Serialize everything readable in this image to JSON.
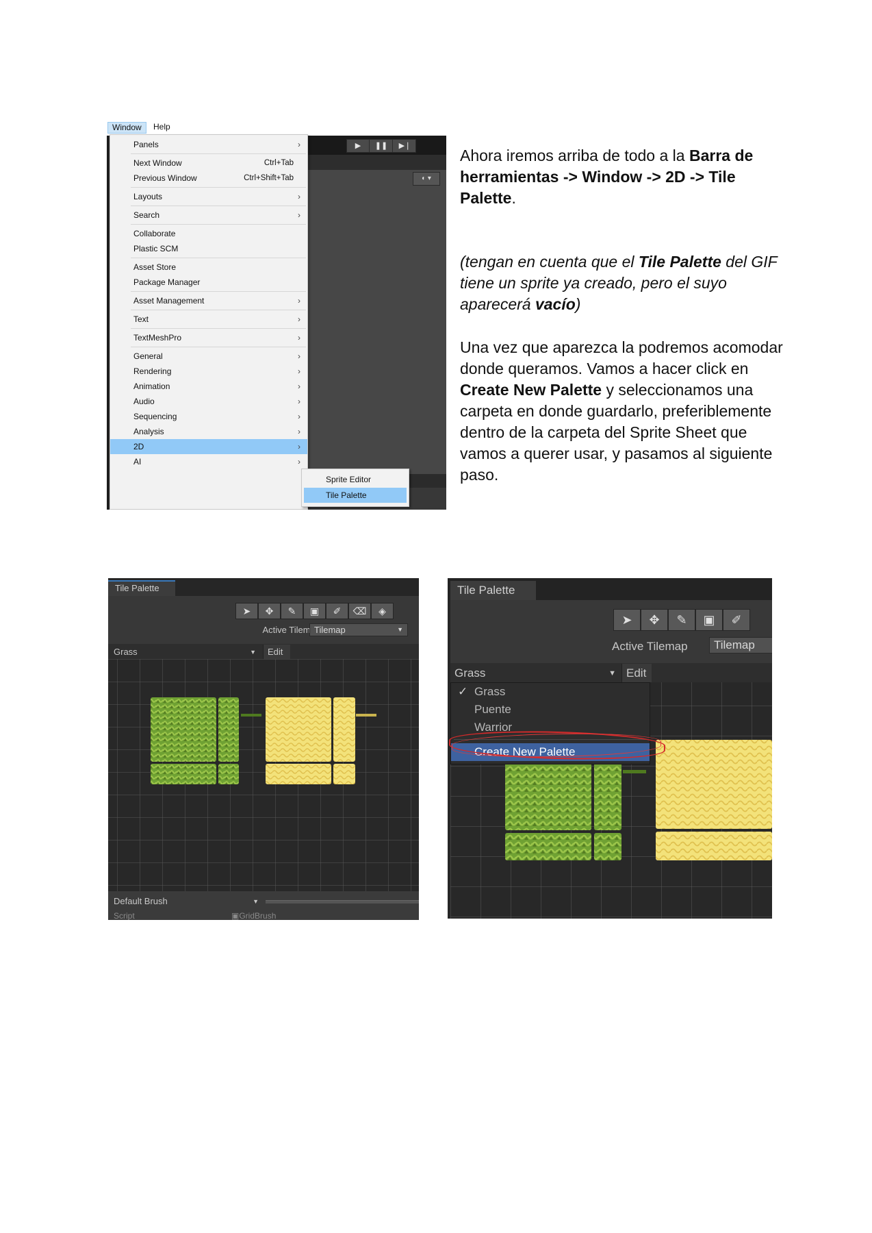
{
  "top_screenshot": {
    "menubar": {
      "window": "Window",
      "help": "Help"
    },
    "window_menu": {
      "items": [
        {
          "label": "Panels",
          "shortcut": "",
          "submenu": true
        },
        {
          "label": "Next Window",
          "shortcut": "Ctrl+Tab",
          "submenu": false
        },
        {
          "label": "Previous Window",
          "shortcut": "Ctrl+Shift+Tab",
          "submenu": false
        },
        {
          "label": "Layouts",
          "shortcut": "",
          "submenu": true
        },
        {
          "label": "Search",
          "shortcut": "",
          "submenu": true
        },
        {
          "label": "Collaborate",
          "shortcut": "",
          "submenu": false
        },
        {
          "label": "Plastic SCM",
          "shortcut": "",
          "submenu": false
        },
        {
          "label": "Asset Store",
          "shortcut": "",
          "submenu": false
        },
        {
          "label": "Package Manager",
          "shortcut": "",
          "submenu": false
        },
        {
          "label": "Asset Management",
          "shortcut": "",
          "submenu": true
        },
        {
          "label": "Text",
          "shortcut": "",
          "submenu": true
        },
        {
          "label": "TextMeshPro",
          "shortcut": "",
          "submenu": true
        },
        {
          "label": "General",
          "shortcut": "",
          "submenu": true
        },
        {
          "label": "Rendering",
          "shortcut": "",
          "submenu": true
        },
        {
          "label": "Animation",
          "shortcut": "",
          "submenu": true
        },
        {
          "label": "Audio",
          "shortcut": "",
          "submenu": true
        },
        {
          "label": "Sequencing",
          "shortcut": "",
          "submenu": true
        },
        {
          "label": "Analysis",
          "shortcut": "",
          "submenu": true
        },
        {
          "label": "2D",
          "shortcut": "",
          "submenu": true,
          "selected": true
        },
        {
          "label": "AI",
          "shortcut": "",
          "submenu": true
        }
      ],
      "arrow_glyph": "›"
    },
    "submenu_2d": {
      "items": [
        {
          "label": "Sprite Editor"
        },
        {
          "label": "Tile Palette",
          "selected": true
        }
      ]
    }
  },
  "instructions": {
    "p1_a": "Ahora iremos arriba de todo a la ",
    "p1_b": "Barra de herramientas -> Window -> 2D -> Tile Palette",
    "p1_c": ".",
    "p2_a": "(tengan en cuenta que el ",
    "p2_b": "Tile Palette",
    "p2_c": " del GIF tiene un sprite ya creado, pero el suyo aparecerá ",
    "p2_d": "vacío",
    "p2_e": ")",
    "p3_a": "Una vez que aparezca la podremos acomodar donde queramos. Vamos a hacer click en ",
    "p3_b": "Create New Palette",
    "p3_c": " y seleccionamos una carpeta en donde guardarlo, preferiblemente dentro  de la carpeta del Sprite Sheet que vamos a querer usar,  y pasamos al siguiente paso."
  },
  "tile_palette_left": {
    "tab": "Tile Palette",
    "active_tilemap_label": "Active Tilemap",
    "active_tilemap_value": "Tilemap",
    "palette_value": "Grass",
    "edit_label": "Edit",
    "brush_value": "Default Brush",
    "script_label": "Script",
    "script_value": "GridBrush"
  },
  "tile_palette_right": {
    "tab": "Tile Palette",
    "active_tilemap_label": "Active Tilemap",
    "active_tilemap_value": "Tilemap",
    "palette_value": "Grass",
    "edit_label": "Edit",
    "palette_options": [
      "Grass",
      "Puente",
      "Warrior"
    ],
    "checked_option": "✓",
    "create_new_palette": "Create New Palette"
  },
  "colors": {
    "menu_selection": "#91c9f7",
    "unity_dark": "#383838",
    "dropdown_highlight": "#3e62a0",
    "annotation_red": "#d52a2a",
    "grass_green": "#7fae3c",
    "sand_yellow": "#f3e27a"
  },
  "icons": {
    "toolbar": [
      "select-icon",
      "move-icon",
      "paint-brush-icon",
      "box-fill-icon",
      "picker-icon",
      "eraser-icon",
      "fill-bucket-icon"
    ],
    "playmode": [
      "play-icon",
      "pause-icon",
      "step-icon"
    ]
  }
}
